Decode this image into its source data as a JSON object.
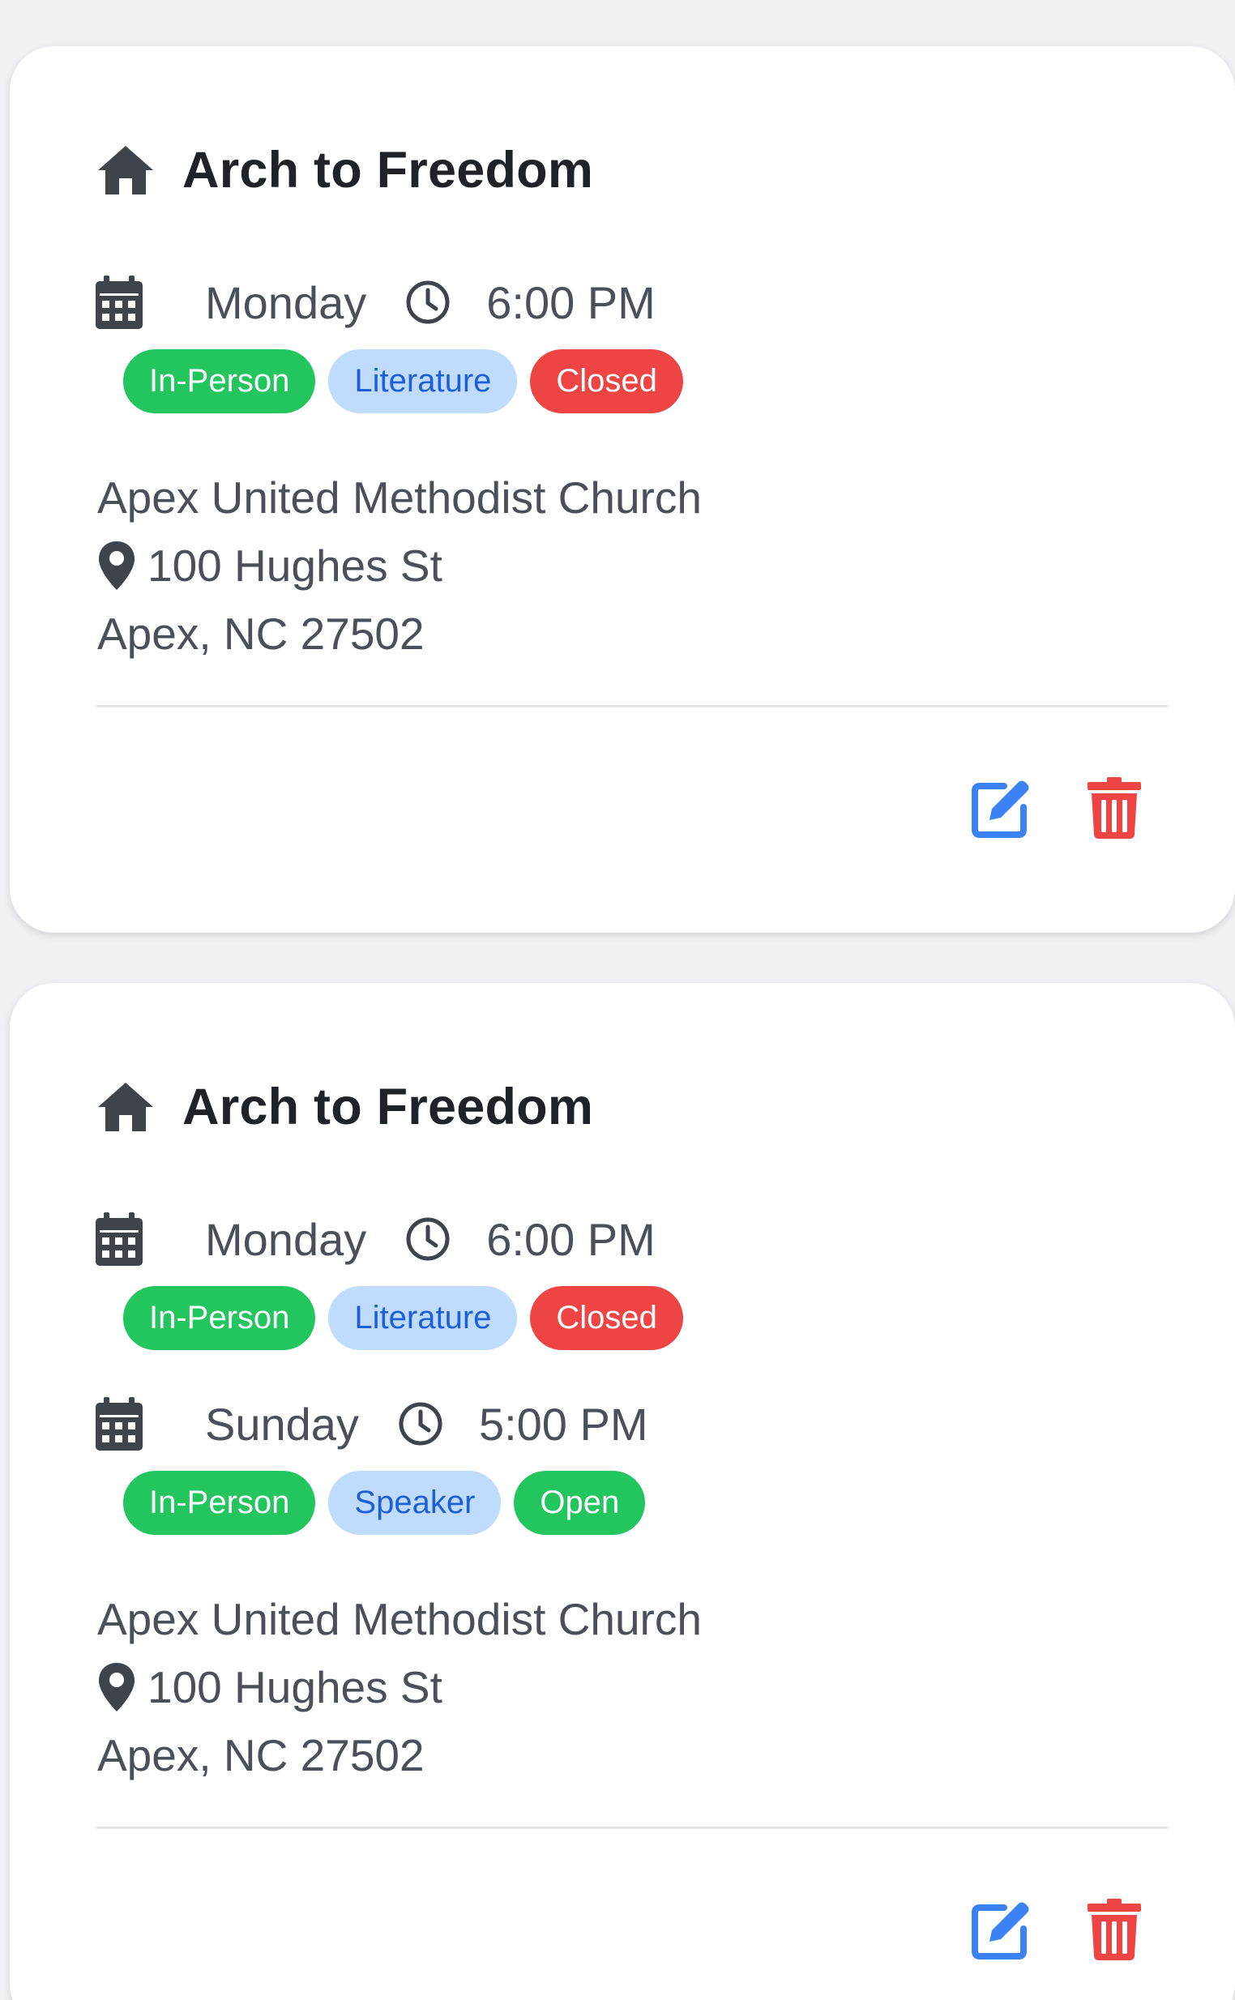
{
  "meetings": [
    {
      "name": "Arch to Freedom",
      "schedules": [
        {
          "day": "Monday",
          "time": "6:00 PM",
          "tags": [
            {
              "label": "In-Person",
              "style": "green"
            },
            {
              "label": "Literature",
              "style": "blue"
            },
            {
              "label": "Closed",
              "style": "red"
            }
          ]
        }
      ],
      "location": {
        "venue": "Apex United Methodist Church",
        "street": "100 Hughes St",
        "city_state_zip": "Apex, NC 27502"
      }
    },
    {
      "name": "Arch to Freedom",
      "schedules": [
        {
          "day": "Monday",
          "time": "6:00 PM",
          "tags": [
            {
              "label": "In-Person",
              "style": "green"
            },
            {
              "label": "Literature",
              "style": "blue"
            },
            {
              "label": "Closed",
              "style": "red"
            }
          ]
        },
        {
          "day": "Sunday",
          "time": "5:00 PM",
          "tags": [
            {
              "label": "In-Person",
              "style": "green"
            },
            {
              "label": "Speaker",
              "style": "blue"
            },
            {
              "label": "Open",
              "style": "green"
            }
          ]
        }
      ],
      "location": {
        "venue": "Apex United Methodist Church",
        "street": "100 Hughes St",
        "city_state_zip": "Apex, NC 27502"
      }
    }
  ],
  "icons": {
    "title": "home-icon",
    "day": "calendar-icon",
    "time": "clock-icon",
    "address": "map-pin-icon",
    "edit": "edit-icon",
    "delete": "trash-icon"
  },
  "colors": {
    "page_background": "#eff1f5",
    "card_background": "#ffffff",
    "tag_green": "#23c55e",
    "tag_blue_bg": "#bfdbfe",
    "tag_blue_text": "#1e5fd8",
    "tag_red": "#ee4444",
    "edit_icon": "#3b82f6",
    "delete_icon": "#ef4444"
  }
}
